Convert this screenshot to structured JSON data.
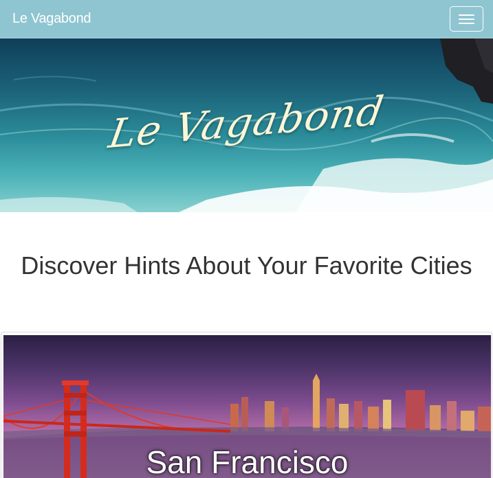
{
  "navbar": {
    "brand": "Le Vagabond",
    "menu_icon": "hamburger-menu-icon"
  },
  "hero": {
    "title": "Le Vagabond"
  },
  "main": {
    "headline": "Discover Hints About Your Favorite Cities"
  },
  "cities": [
    {
      "name": "San Francisco"
    }
  ]
}
